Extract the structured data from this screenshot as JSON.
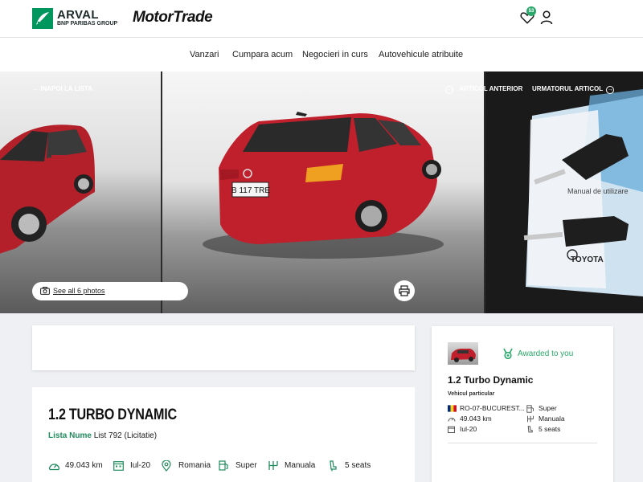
{
  "header": {
    "brand_primary": "ARVAL",
    "brand_sub": "BNP PARIBAS GROUP",
    "brand_secondary": "MotorTrade",
    "favorites_count": "53",
    "accent_color": "#00965e"
  },
  "nav": {
    "items": [
      "Vanzari",
      "Cumpara acum",
      "Negocieri in curs",
      "Autovehicule atribuite"
    ]
  },
  "gallery": {
    "back_label": "INAPOI LA LISTA",
    "prev_label": "ARTICOL ANTERIOR",
    "next_label": "URMATORUL ARTICOL",
    "see_all_label": "See all 6 photos",
    "plate_text": "B 117 TRE",
    "manual_text": "Manual de utilizare",
    "manual_brand": "TOYOTA"
  },
  "vehicle": {
    "title": "1.2 TURBO DYNAMIC",
    "list_label": "Lista Nume",
    "list_value": "List 792 (Licitatie)",
    "specs": {
      "mileage": "49.043 km",
      "date": "Iul-20",
      "country": "Romania",
      "fuel": "Super",
      "gearbox": "Manuala",
      "seats": "5 seats"
    }
  },
  "side_card": {
    "awarded_label": "Awarded to you",
    "title": "1.2 Turbo Dynamic",
    "subtitle": "Vehicul particular",
    "location": "RO-07-BUCUREST...",
    "fuel": "Super",
    "mileage": "49.043 km",
    "gearbox": "Manuala",
    "date": "Iul-20",
    "seats": "5 seats"
  }
}
